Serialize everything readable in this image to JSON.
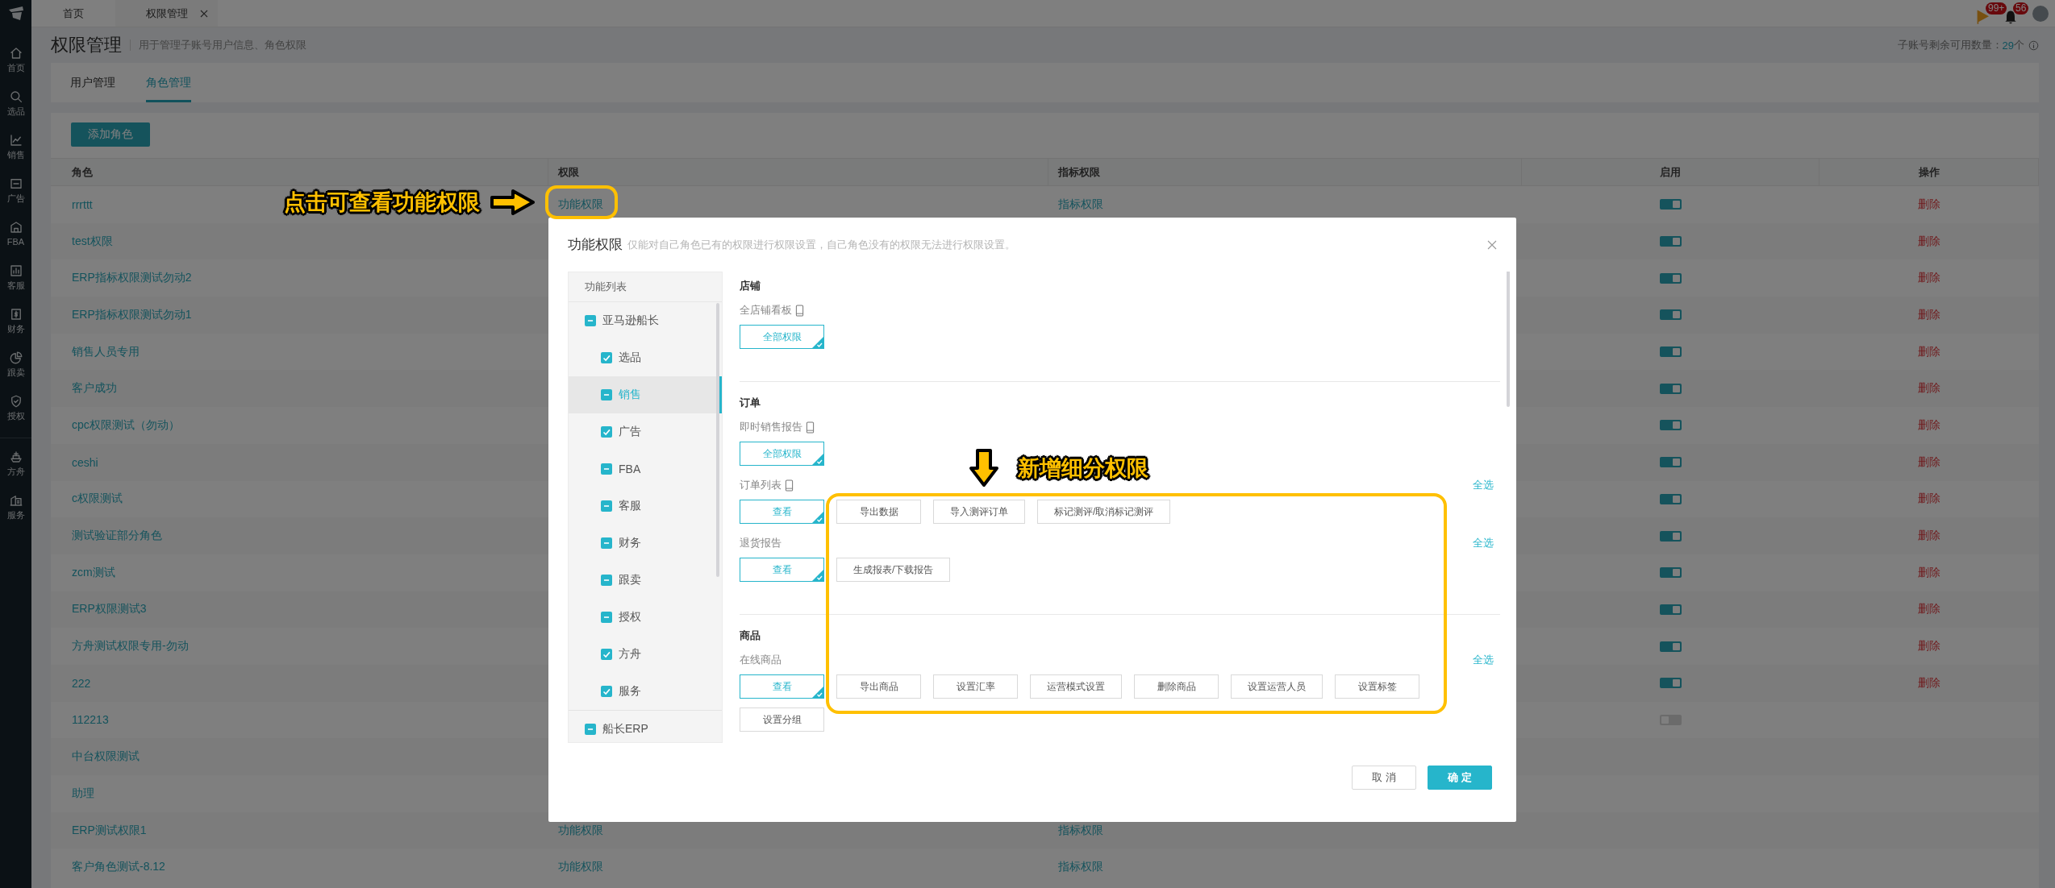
{
  "tab_bar": {
    "tabs": [
      {
        "label": "首页",
        "selected": false,
        "closable": false
      },
      {
        "label": "权限管理",
        "selected": true,
        "closable": true
      }
    ],
    "flag_badge": "99+",
    "bell_badge": "56"
  },
  "sidebar": {
    "groups": [
      [
        {
          "label": "首页"
        },
        {
          "label": "选品"
        },
        {
          "label": "销售"
        },
        {
          "label": "广告"
        },
        {
          "label": "FBA"
        },
        {
          "label": "客服"
        },
        {
          "label": "财务"
        },
        {
          "label": "跟卖"
        },
        {
          "label": "授权"
        }
      ],
      [
        {
          "label": "方舟"
        },
        {
          "label": "服务"
        }
      ]
    ]
  },
  "header": {
    "title": "权限管理",
    "subtitle": "用于管理子账号用户信息、角色权限",
    "quota_label": "子账号剩余可用数量：",
    "quota_value": "29",
    "quota_unit": "个"
  },
  "tabs": [
    {
      "label": "用户管理",
      "selected": false
    },
    {
      "label": "角色管理",
      "selected": true
    }
  ],
  "add_button": "添加角色",
  "table": {
    "columns": [
      "角色",
      "权限",
      "指标权限",
      "启用",
      "操作"
    ],
    "rows": [
      {
        "role": "rrrttt",
        "permission": "功能权限",
        "metric": "指标权限",
        "enabled": true,
        "action": "删除"
      },
      {
        "role": "test权限",
        "enabled": true,
        "action": "删除"
      },
      {
        "role": "ERP指标权限测试勿动2",
        "enabled": true,
        "action": "删除"
      },
      {
        "role": "ERP指标权限测试勿动1",
        "enabled": true,
        "action": "删除"
      },
      {
        "role": "销售人员专用",
        "enabled": true,
        "action": "删除"
      },
      {
        "role": "客户成功",
        "enabled": true,
        "action": "删除"
      },
      {
        "role": "cpc权限测试（勿动）",
        "enabled": true,
        "action": "删除"
      },
      {
        "role": "ceshi",
        "enabled": true,
        "action": "删除"
      },
      {
        "role": "c权限测试",
        "enabled": true,
        "action": "删除"
      },
      {
        "role": "测试验证部分角色",
        "enabled": true,
        "action": "删除"
      },
      {
        "role": "zcm测试",
        "enabled": true,
        "action": "删除"
      },
      {
        "role": "ERP权限测试3",
        "enabled": true,
        "action": "删除"
      },
      {
        "role": "方舟测试权限专用-勿动",
        "enabled": true,
        "action": "删除"
      },
      {
        "role": "222",
        "enabled": true,
        "action": "删除"
      },
      {
        "role": "112213",
        "enabled": false
      },
      {
        "role": "中台权限测试"
      },
      {
        "role": "助理"
      },
      {
        "role": "ERP测试权限1",
        "permission": "功能权限",
        "metric": "指标权限"
      },
      {
        "role": "客户角色测试-8.12",
        "permission": "功能权限",
        "metric": "指标权限"
      }
    ]
  },
  "modal": {
    "title": "功能权限",
    "hint": "仅能对自己角色已有的权限进行权限设置，自己角色没有的权限无法进行权限设置。",
    "tree": {
      "header": "功能列表",
      "items": [
        {
          "label": "亚马逊船长",
          "checked": false,
          "indeterminate": true,
          "selected": false,
          "children": [
            {
              "label": "选品",
              "checked": true,
              "selected": false
            },
            {
              "label": "销售",
              "checked": false,
              "indeterminate": true,
              "selected": true
            },
            {
              "label": "广告",
              "checked": true,
              "selected": false
            },
            {
              "label": "FBA",
              "checked": false,
              "indeterminate": true,
              "selected": false
            },
            {
              "label": "客服",
              "checked": false,
              "indeterminate": true,
              "selected": false
            },
            {
              "label": "财务",
              "checked": false,
              "indeterminate": true,
              "selected": false
            },
            {
              "label": "跟卖",
              "checked": false,
              "indeterminate": true,
              "selected": false
            },
            {
              "label": "授权",
              "checked": false,
              "indeterminate": true,
              "selected": false
            },
            {
              "label": "方舟",
              "checked": true,
              "selected": false
            },
            {
              "label": "服务",
              "checked": true,
              "selected": false
            }
          ]
        },
        {
          "label": "船长ERP",
          "checked": false,
          "indeterminate": true,
          "selected": false
        }
      ]
    },
    "sections": [
      {
        "title": "店铺",
        "items": [
          {
            "label": "全店铺看板",
            "mobile": true,
            "main": {
              "label": "全部权限",
              "selected": true
            }
          }
        ]
      },
      {
        "title": "订单",
        "items": [
          {
            "label": "即时销售报告",
            "mobile": true,
            "main": {
              "label": "全部权限",
              "selected": true
            }
          },
          {
            "label": "订单列表",
            "mobile": true,
            "select_all": "全选",
            "main": {
              "label": "查看",
              "selected": true
            },
            "options": [
              "导出数据",
              "导入测评订单",
              "标记测评/取消标记测评"
            ]
          },
          {
            "label": "退货报告",
            "mobile": false,
            "select_all": "全选",
            "main": {
              "label": "查看",
              "selected": true
            },
            "options": [
              "生成报表/下载报告"
            ]
          }
        ]
      },
      {
        "title": "商品",
        "items": [
          {
            "label": "在线商品",
            "mobile": false,
            "select_all": "全选",
            "main": {
              "label": "查看",
              "selected": true
            },
            "options": [
              "导出商品",
              "设置汇率",
              "运营模式设置",
              "删除商品",
              "设置运营人员",
              "设置标签",
              "设置分组"
            ]
          }
        ]
      }
    ],
    "cancel": "取 消",
    "confirm": "确 定"
  },
  "annotations": [
    {
      "text": "点击可查看功能权限",
      "kind": "right_arrow"
    },
    {
      "text": "新增细分权限",
      "kind": "down_arrow"
    }
  ]
}
